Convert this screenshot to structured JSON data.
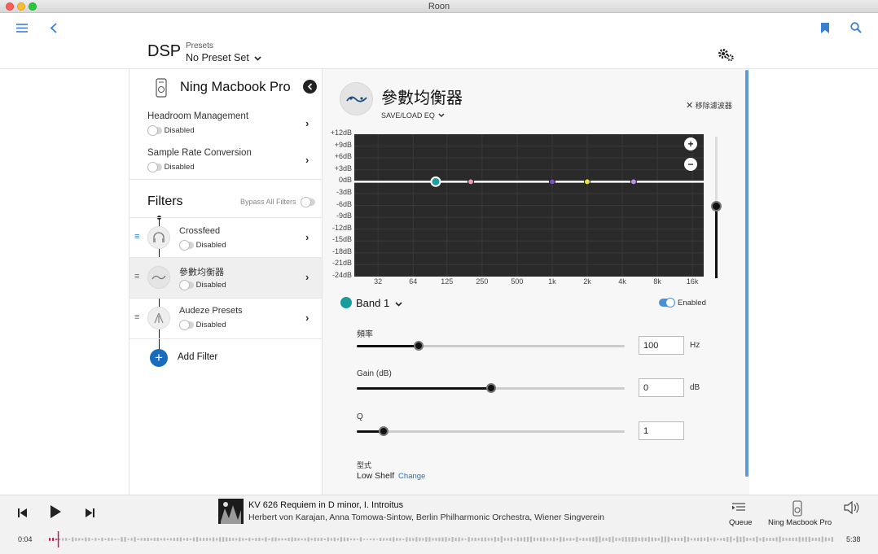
{
  "window": {
    "title": "Roon"
  },
  "header": {
    "section_title": "DSP",
    "presets_label": "Presets",
    "preset_value": "No Preset Set"
  },
  "device": {
    "name": "Ning Macbook Pro"
  },
  "settings": [
    {
      "label": "Headroom Management",
      "state": "Disabled"
    },
    {
      "label": "Sample Rate Conversion",
      "state": "Disabled"
    }
  ],
  "filters": {
    "title": "Filters",
    "bypass_label": "Bypass All Filters",
    "add_label": "Add Filter",
    "items": [
      {
        "label": "Crossfeed",
        "state": "Disabled"
      },
      {
        "label": "參數均衡器",
        "state": "Disabled"
      },
      {
        "label": "Audeze Presets",
        "state": "Disabled"
      }
    ]
  },
  "eq": {
    "title": "參數均衡器",
    "save_load": "SAVE/LOAD EQ",
    "remove_filter": "移除濾波器",
    "y_labels": [
      "+12dB",
      "+9dB",
      "+6dB",
      "+3dB",
      "0dB",
      "-3dB",
      "-6dB",
      "-9dB",
      "-12dB",
      "-15dB",
      "-18dB",
      "-21dB",
      "-24dB"
    ],
    "x_labels": [
      "32",
      "64",
      "125",
      "250",
      "500",
      "1k",
      "2k",
      "4k",
      "8k",
      "16k"
    ],
    "zoom_in": "+",
    "zoom_out": "−",
    "band_points": [
      {
        "freq": 100,
        "color": "#1e9e9e"
      },
      {
        "freq": 200,
        "color": "#e79ab8"
      },
      {
        "freq": 1000,
        "color": "#7a4fc7"
      },
      {
        "freq": 2000,
        "color": "#f2e23a"
      },
      {
        "freq": 5000,
        "color": "#c08ee8"
      }
    ],
    "volume_level": 0.5
  },
  "band": {
    "name": "Band 1",
    "color": "#1a9c9c",
    "enabled_label": "Enabled",
    "freq": {
      "label": "頻率",
      "value": "100",
      "unit": "Hz",
      "level": 0.23
    },
    "gain": {
      "label": "Gain (dB)",
      "value": "0",
      "unit": "dB",
      "level": 0.5
    },
    "q": {
      "label": "Q",
      "value": "1",
      "unit": "",
      "level": 0.1
    },
    "type_label": "型式",
    "type_value": "Low Shelf",
    "change_label": "Change"
  },
  "player": {
    "track": "KV 626 Requiem in D minor, I. Introitus",
    "artists": "Herbert von Karajan, Anna Tomowa-Sintow, Berlin Philharmonic Orchestra, Wiener Singverein",
    "elapsed": "0:04",
    "total": "5:38",
    "queue_label": "Queue",
    "zone_label": "Ning Macbook Pro",
    "progress": 0.012
  }
}
